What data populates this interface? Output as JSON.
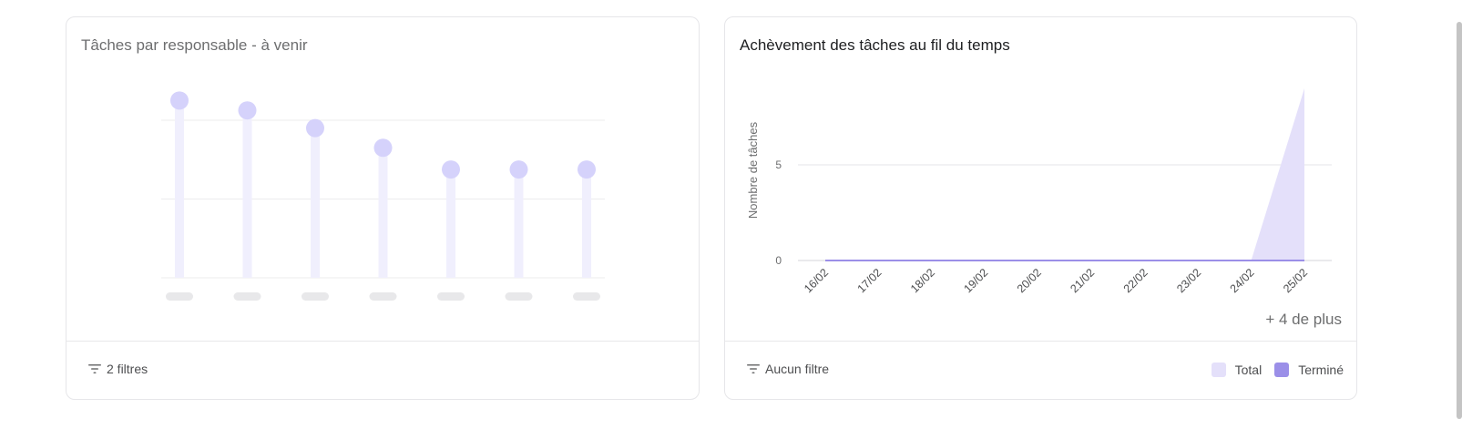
{
  "left_card": {
    "title": "Tâches par responsable - à venir",
    "filter_label": "2 filtres",
    "chart_data": {
      "type": "scatter",
      "title": "Tâches par responsable - à venir",
      "values": [
        9,
        8.5,
        7.6,
        6.6,
        5.5,
        5.5,
        5.5
      ],
      "ylim": [
        0,
        8
      ],
      "gridlines": [
        0,
        4,
        8
      ],
      "grid": true,
      "color": "#d5d2fb",
      "stem_color": "#f0effd"
    }
  },
  "right_card": {
    "title": "Achèvement des tâches au fil du temps",
    "filter_label": "Aucun filtre",
    "more_label": "+ 4 de plus",
    "legend": [
      {
        "label": "Total",
        "color": "#e4e0fa"
      },
      {
        "label": "Terminé",
        "color": "#9b8fe8"
      }
    ],
    "chart_data": {
      "type": "area",
      "title": "Achèvement des tâches au fil du temps",
      "ylabel": "Nombre de tâches",
      "x": [
        "16/02",
        "17/02",
        "18/02",
        "19/02",
        "20/02",
        "21/02",
        "22/02",
        "23/02",
        "24/02",
        "25/02"
      ],
      "ylim": [
        0,
        9
      ],
      "yticks": [
        0,
        5
      ],
      "grid": true,
      "series": [
        {
          "name": "Total",
          "values": [
            0,
            0,
            0,
            0,
            0,
            0,
            0,
            0,
            0,
            9
          ],
          "color": "#e4e0fa"
        },
        {
          "name": "Terminé",
          "values": [
            0,
            0,
            0,
            0,
            0,
            0,
            0,
            0,
            0,
            0
          ],
          "color": "#9b8fe8"
        }
      ]
    }
  }
}
